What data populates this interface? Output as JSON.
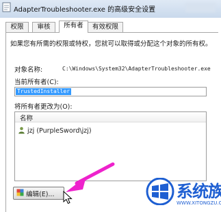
{
  "window": {
    "title": "AdapterTroubleshooter.exe 的高级安全设置"
  },
  "tabs": [
    "权限",
    "审核",
    "所有者",
    "有效权限"
  ],
  "panel": {
    "description": "如果您有所需的权限或特权，您就可以取得或分配这个对象的所有权。",
    "object_name_label": "对象名称:",
    "object_name_value": "C:\\Windows\\System32\\AdapterTroubleshooter.exe",
    "current_owner_label": "当前所有者(C):",
    "current_owner_value": "TrustedInstaller",
    "change_owner_label": "将所有者更改为(O):",
    "list_header": "名称",
    "list_items": [
      "jzj (PurpleSword\\jzj)"
    ],
    "edit_button_label": "编辑(E)..."
  },
  "watermark": {
    "brand": "系统族",
    "url": "WWW.XITONGZU.COM"
  },
  "colors": {
    "selection": "#3399ff",
    "arrow": "#ee22cc",
    "watermark_blue": "#1e5fd2"
  }
}
